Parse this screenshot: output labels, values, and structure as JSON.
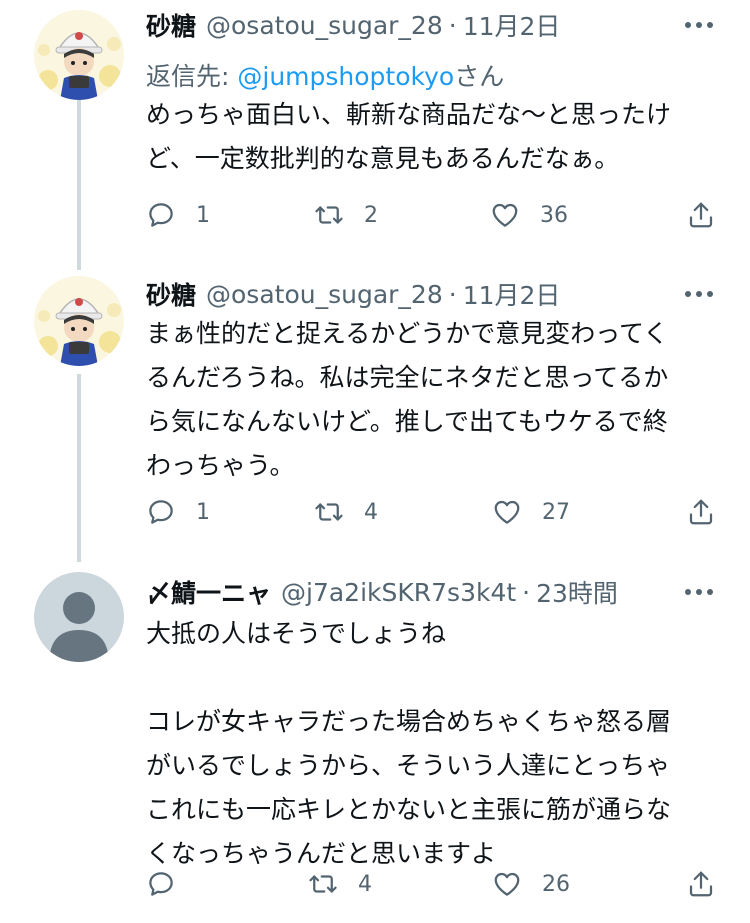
{
  "tweets": [
    {
      "display_name": "砂糖",
      "handle": "@osatou_sugar_28",
      "separator": "·",
      "timestamp": "11月2日",
      "reply_prefix": "返信先: ",
      "reply_handle": "@jumpshoptokyo",
      "reply_suffix": "さん",
      "text": "めっちゃ面白い、斬新な商品だな〜と思ったけ\nど、一定数批判的な意見もあるんだなぁ。",
      "reply_count": "1",
      "retweet_count": "2",
      "like_count": "36"
    },
    {
      "display_name": "砂糖",
      "handle": "@osatou_sugar_28",
      "separator": "·",
      "timestamp": "11月2日",
      "text": "まぁ性的だと捉えるかどうかで意見変わってく\nるんだろうね。私は完全にネタだと思ってるか\nら気になんないけど。推しで出てもウケるで終\nわっちゃう。",
      "reply_count": "1",
      "retweet_count": "4",
      "like_count": "27"
    },
    {
      "display_name": "〆鯖一ニャ",
      "handle": "@j7a2ikSKR7s3k4t",
      "separator": "·",
      "timestamp": "23時間",
      "text": "大抵の人はそうでしょうね\n\nコレが女キャラだった場合めちゃくちゃ怒る層\nがいるでしょうから、そういう人達にとっちゃ\nこれにも一応キレとかないと主張に筋が通らな\nくなっちゃうんだと思いますよ",
      "reply_count": "",
      "retweet_count": "4",
      "like_count": "26"
    }
  ],
  "colors": {
    "text_primary": "#0f1419",
    "text_secondary": "#536471",
    "link": "#1d9bf0",
    "thread_line": "#cfd9de",
    "default_avatar_bg": "#ccd6dd"
  },
  "icons": [
    "more-icon",
    "reply-icon",
    "retweet-icon",
    "like-icon",
    "share-icon",
    "default-avatar-icon"
  ]
}
